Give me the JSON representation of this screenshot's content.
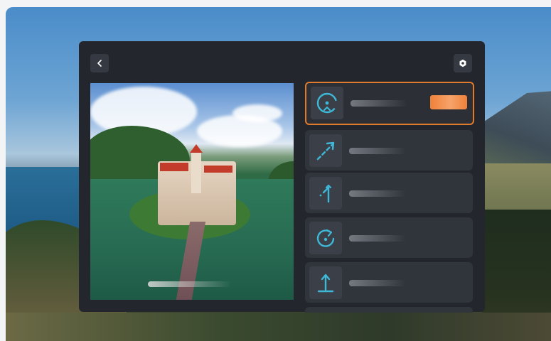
{
  "background": {
    "description_colors": {
      "sky": "#4a8cc9",
      "sea": "#1d5a85",
      "forest": "#2b3f2c"
    }
  },
  "panel": {
    "back_icon": "chevron-left-icon",
    "settings_icon": "gear-icon",
    "preview": {
      "caption": ""
    },
    "modes": [
      {
        "icon": "orbit-icon",
        "label": "",
        "badge": "",
        "selected": true
      },
      {
        "icon": "diagonal-path-icon",
        "label": "",
        "selected": false
      },
      {
        "icon": "return-path-icon",
        "label": "",
        "selected": false
      },
      {
        "icon": "rotate-icon",
        "label": "",
        "selected": false
      },
      {
        "icon": "ascend-icon",
        "label": "",
        "selected": false
      }
    ]
  },
  "colors": {
    "accent": "#e07a2c",
    "icon": "#3fb8d8",
    "panel": "#23262c",
    "item": "#30343b"
  }
}
